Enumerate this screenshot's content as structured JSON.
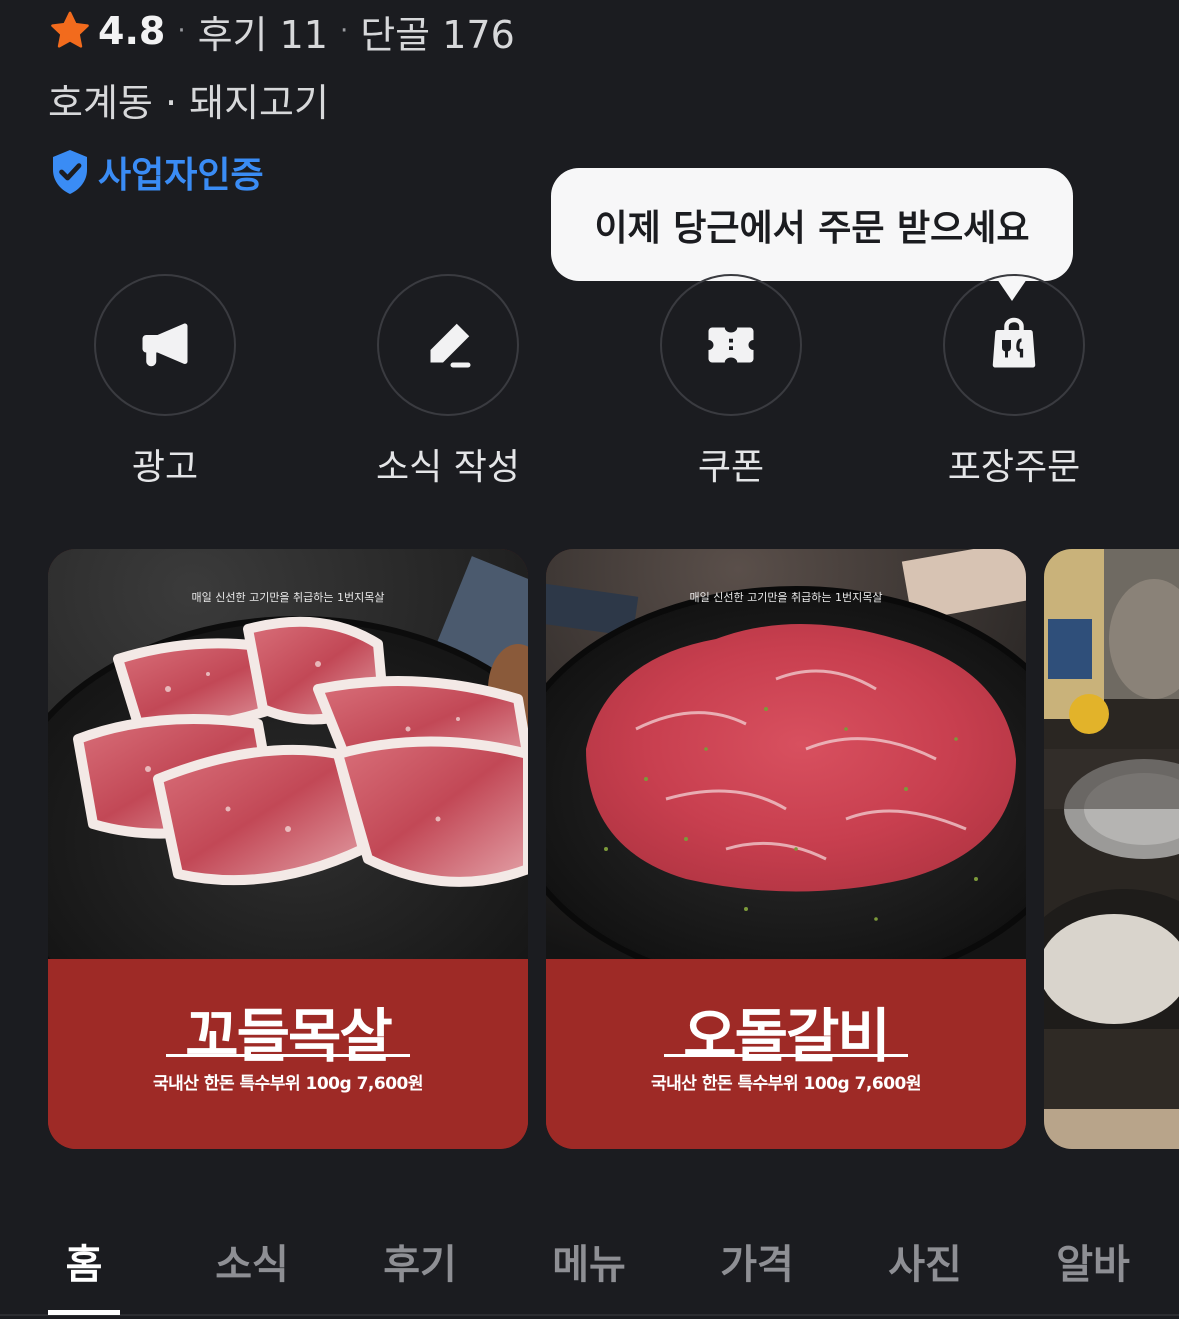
{
  "header": {
    "rating": "4.8",
    "separator": "·",
    "reviews": "후기 11",
    "regulars": "단골 176",
    "category": "호계동 · 돼지고기",
    "verified_label": "사업자인증"
  },
  "tooltip": {
    "text": "이제 당근에서 주문 받으세요"
  },
  "actions": [
    {
      "label": "광고",
      "icon": "megaphone-icon"
    },
    {
      "label": "소식 작성",
      "icon": "pencil-icon"
    },
    {
      "label": "쿠폰",
      "icon": "coupon-icon"
    },
    {
      "label": "포장주문",
      "icon": "takeout-bag-icon"
    }
  ],
  "cards": [
    {
      "tagline": "매일 신선한 고기만을 취급하는 1번지목살",
      "name": "꼬들목살",
      "price": "국내산 한돈 특수부위 100g 7,600원"
    },
    {
      "tagline": "매일 신선한 고기만을 취급하는 1번지목살",
      "name": "오돌갈비",
      "price": "국내산 한돈 특수부위 100g 7,600원"
    }
  ],
  "tabs": [
    "홈",
    "소식",
    "후기",
    "메뉴",
    "가격",
    "사진",
    "알바"
  ],
  "active_tab": "홈",
  "colors": {
    "background": "#1b1c20",
    "accent_blue": "#3a8cf5",
    "star_orange": "#f26b1d",
    "card_red": "#9e2a26"
  }
}
